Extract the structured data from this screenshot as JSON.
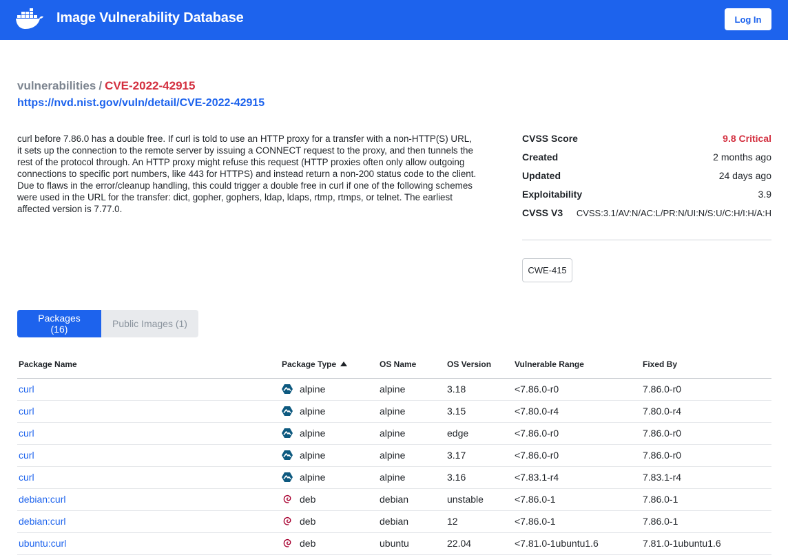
{
  "header": {
    "logo_icon": "docker-whale-icon",
    "title": "Image Vulnerability Database",
    "login_label": "Log In",
    "brand_color": "#1d63ed"
  },
  "breadcrumb": {
    "root": "vulnerabilities",
    "separator": "/",
    "current": "CVE-2022-42915"
  },
  "nvd_link": "https://nvd.nist.gov/vuln/detail/CVE-2022-42915",
  "description": "curl before 7.86.0 has a double free. If curl is told to use an HTTP proxy for a transfer with a non-HTTP(S) URL, it sets up the connection to the remote server by issuing a CONNECT request to the proxy, and then tunnels the rest of the protocol through. An HTTP proxy might refuse this request (HTTP proxies often only allow outgoing connections to specific port numbers, like 443 for HTTPS) and instead return a non-200 status code to the client. Due to flaws in the error/cleanup handling, this could trigger a double free in curl if one of the following schemes were used in the URL for the transfer: dict, gopher, gophers, ldap, ldaps, rtmp, rtmps, or telnet. The earliest affected version is 7.77.0.",
  "meta": {
    "cvss_score_label": "CVSS Score",
    "cvss_score_value": "9.8 Critical",
    "created_label": "Created",
    "created_value": "2 months ago",
    "updated_label": "Updated",
    "updated_value": "24 days ago",
    "exploitability_label": "Exploitability",
    "exploitability_value": "3.9",
    "cvss_v3_label": "CVSS V3",
    "cvss_v3_value": "CVSS:3.1/AV:N/AC:L/PR:N/UI:N/S:U/C:H/I:H/A:H",
    "critical_color": "#d32f3f"
  },
  "cwe": "CWE-415",
  "tabs": {
    "packages": "Packages (16)",
    "public_images": "Public Images (1)"
  },
  "table": {
    "headers": {
      "name": "Package Name",
      "type": "Package Type",
      "os_name": "OS Name",
      "os_version": "OS Version",
      "range": "Vulnerable Range",
      "fixed": "Fixed By"
    },
    "rows": [
      {
        "name": "curl",
        "type": "alpine",
        "type_icon": "alpine-icon",
        "os": "alpine",
        "osv": "3.18",
        "range": "<7.86.0-r0",
        "fixed": "7.86.0-r0"
      },
      {
        "name": "curl",
        "type": "alpine",
        "type_icon": "alpine-icon",
        "os": "alpine",
        "osv": "3.15",
        "range": "<7.80.0-r4",
        "fixed": "7.80.0-r4"
      },
      {
        "name": "curl",
        "type": "alpine",
        "type_icon": "alpine-icon",
        "os": "alpine",
        "osv": "edge",
        "range": "<7.86.0-r0",
        "fixed": "7.86.0-r0"
      },
      {
        "name": "curl",
        "type": "alpine",
        "type_icon": "alpine-icon",
        "os": "alpine",
        "osv": "3.17",
        "range": "<7.86.0-r0",
        "fixed": "7.86.0-r0"
      },
      {
        "name": "curl",
        "type": "alpine",
        "type_icon": "alpine-icon",
        "os": "alpine",
        "osv": "3.16",
        "range": "<7.83.1-r4",
        "fixed": "7.83.1-r4"
      },
      {
        "name": "debian:curl",
        "type": "deb",
        "type_icon": "debian-icon",
        "os": "debian",
        "osv": "unstable",
        "range": "<7.86.0-1",
        "fixed": "7.86.0-1"
      },
      {
        "name": "debian:curl",
        "type": "deb",
        "type_icon": "debian-icon",
        "os": "debian",
        "osv": "12",
        "range": "<7.86.0-1",
        "fixed": "7.86.0-1"
      },
      {
        "name": "ubuntu:curl",
        "type": "deb",
        "type_icon": "debian-icon",
        "os": "ubuntu",
        "osv": "22.04",
        "range": "<7.81.0-1ubuntu1.6",
        "fixed": "7.81.0-1ubuntu1.6"
      }
    ]
  }
}
